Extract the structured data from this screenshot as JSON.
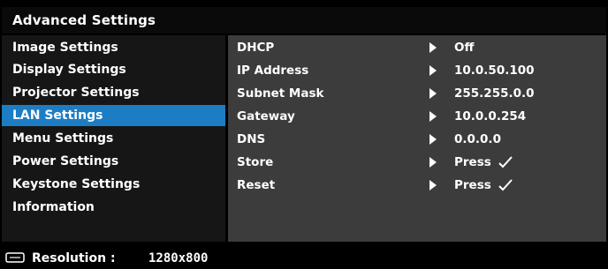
{
  "window": {
    "title": "Advanced Settings"
  },
  "menu": {
    "items": [
      {
        "label": "Image Settings"
      },
      {
        "label": "Display Settings"
      },
      {
        "label": "Projector Settings"
      },
      {
        "label": "LAN Settings"
      },
      {
        "label": "Menu Settings"
      },
      {
        "label": "Power Settings"
      },
      {
        "label": "Keystone Settings"
      },
      {
        "label": "Information"
      }
    ],
    "selected": "LAN Settings"
  },
  "lan": {
    "rows": [
      {
        "label": "DHCP",
        "value": "Off",
        "icon": "arrow-right-icon"
      },
      {
        "label": "IP Address",
        "value": "10.0.50.100",
        "icon": "arrow-right-icon"
      },
      {
        "label": "Subnet Mask",
        "value": "255.255.0.0",
        "icon": "arrow-right-icon"
      },
      {
        "label": "Gateway",
        "value": "10.0.0.254",
        "icon": "arrow-right-icon"
      },
      {
        "label": "DNS",
        "value": "0.0.0.0",
        "icon": "arrow-right-icon"
      },
      {
        "label": "Store",
        "value": "Press",
        "icon": "arrow-right-icon",
        "check": "checkmark-icon"
      },
      {
        "label": "Reset",
        "value": "Press",
        "icon": "arrow-right-icon",
        "check": "checkmark-icon"
      }
    ]
  },
  "status": {
    "resolution_label": "Resolution :",
    "resolution_value": "1280x800",
    "icon": "display-input-icon"
  },
  "colors": {
    "background": "#000000",
    "menu_background": "#161616",
    "panel_background": "#3c3c3c",
    "highlight": "#1d7dc4",
    "text": "#ffffff"
  }
}
